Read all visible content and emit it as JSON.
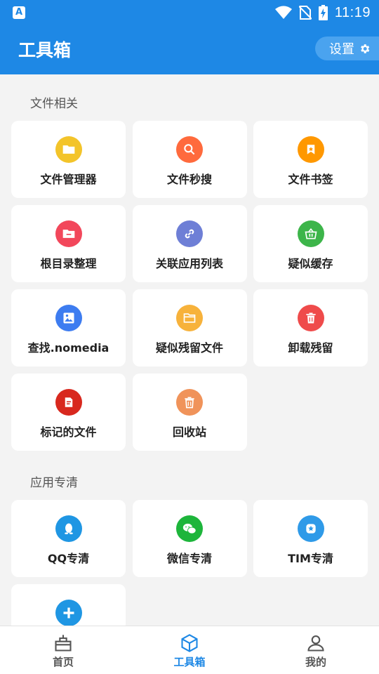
{
  "status_bar": {
    "time": "11:19",
    "left_icon_letter": "A"
  },
  "header": {
    "title": "工具箱",
    "settings_label": "设置"
  },
  "sections": [
    {
      "title": "文件相关",
      "items": [
        {
          "label": "文件管理器",
          "icon": "folder-icon",
          "color": "#f3c42a"
        },
        {
          "label": "文件秒搜",
          "icon": "search-icon",
          "color": "#ff6a3d"
        },
        {
          "label": "文件书签",
          "icon": "bookmark-icon",
          "color": "#ff9800"
        },
        {
          "label": "根目录整理",
          "icon": "folder-minus-icon",
          "color": "#f2475b"
        },
        {
          "label": "关联应用列表",
          "icon": "link-icon",
          "color": "#6e7fd6"
        },
        {
          "label": "疑似缓存",
          "icon": "basket-icon",
          "color": "#3db54a"
        },
        {
          "label": "查找.nomedia",
          "icon": "image-icon",
          "color": "#3d7cf0"
        },
        {
          "label": "疑似残留文件",
          "icon": "folder-outline-icon",
          "color": "#f7b23b"
        },
        {
          "label": "卸载残留",
          "icon": "trash-icon",
          "color": "#ef4b4b"
        },
        {
          "label": "标记的文件",
          "icon": "marked-file-icon",
          "color": "#d8281e"
        },
        {
          "label": "回收站",
          "icon": "recycle-bin-icon",
          "color": "#f0935a"
        }
      ]
    },
    {
      "title": "应用专清",
      "items": [
        {
          "label": "QQ专清",
          "icon": "qq-icon",
          "color": "#1f96e3"
        },
        {
          "label": "微信专清",
          "icon": "wechat-icon",
          "color": "#1db53b"
        },
        {
          "label": "TIM专清",
          "icon": "tim-icon",
          "color": "#2f9ae8"
        },
        {
          "label": "",
          "icon": "add-icon",
          "color": "#1f96e3"
        }
      ]
    }
  ],
  "bottom_nav": [
    {
      "label": "首页",
      "icon": "home-basket-icon",
      "active": false
    },
    {
      "label": "工具箱",
      "icon": "cube-icon",
      "active": true
    },
    {
      "label": "我的",
      "icon": "user-icon",
      "active": false
    }
  ],
  "colors": {
    "primary": "#1e88e5",
    "background": "#f3f3f3"
  }
}
